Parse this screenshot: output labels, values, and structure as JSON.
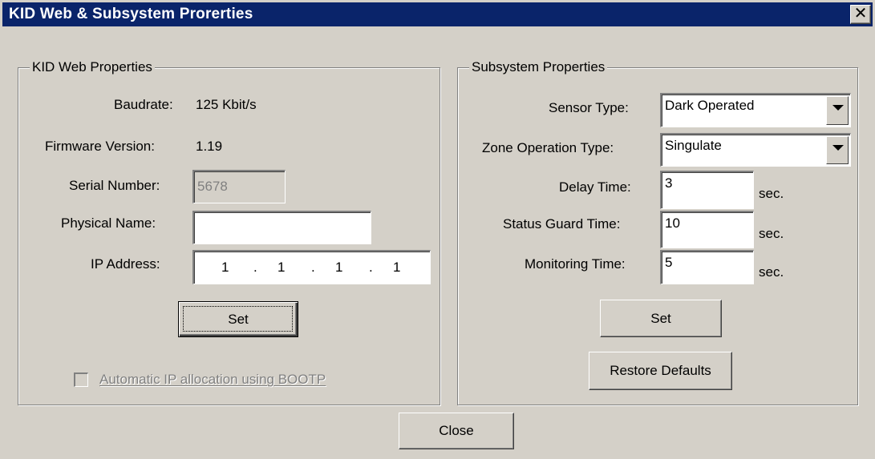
{
  "window": {
    "title": "KID Web & Subsystem Prorerties",
    "close_glyph": "✕"
  },
  "kidweb": {
    "legend": "KID Web Properties",
    "baudrate_label": "Baudrate:",
    "baudrate_value": "125 Kbit/s",
    "firmware_label": "Firmware Version:",
    "firmware_value": "1.19",
    "serial_label": "Serial Number:",
    "serial_value": "5678",
    "physname_label": "Physical Name:",
    "physname_value": "",
    "ip_label": "IP Address:",
    "ip_octets": [
      "1",
      "1",
      "1",
      "1"
    ],
    "ip_separator": ".",
    "set_label": "Set",
    "bootp_label": "Automatic IP allocation using BOOTP"
  },
  "subsystem": {
    "legend": "Subsystem Properties",
    "sensor_label": "Sensor Type:",
    "sensor_value": "Dark Operated",
    "zone_label": "Zone Operation Type:",
    "zone_value": "Singulate",
    "delay_label": "Delay Time:",
    "delay_value": "3",
    "status_label": "Status Guard Time:",
    "status_value": "10",
    "monitor_label": "Monitoring Time:",
    "monitor_value": "5",
    "unit": "sec.",
    "set_label": "Set",
    "restore_label": "Restore Defaults"
  },
  "footer": {
    "close_label": "Close"
  }
}
